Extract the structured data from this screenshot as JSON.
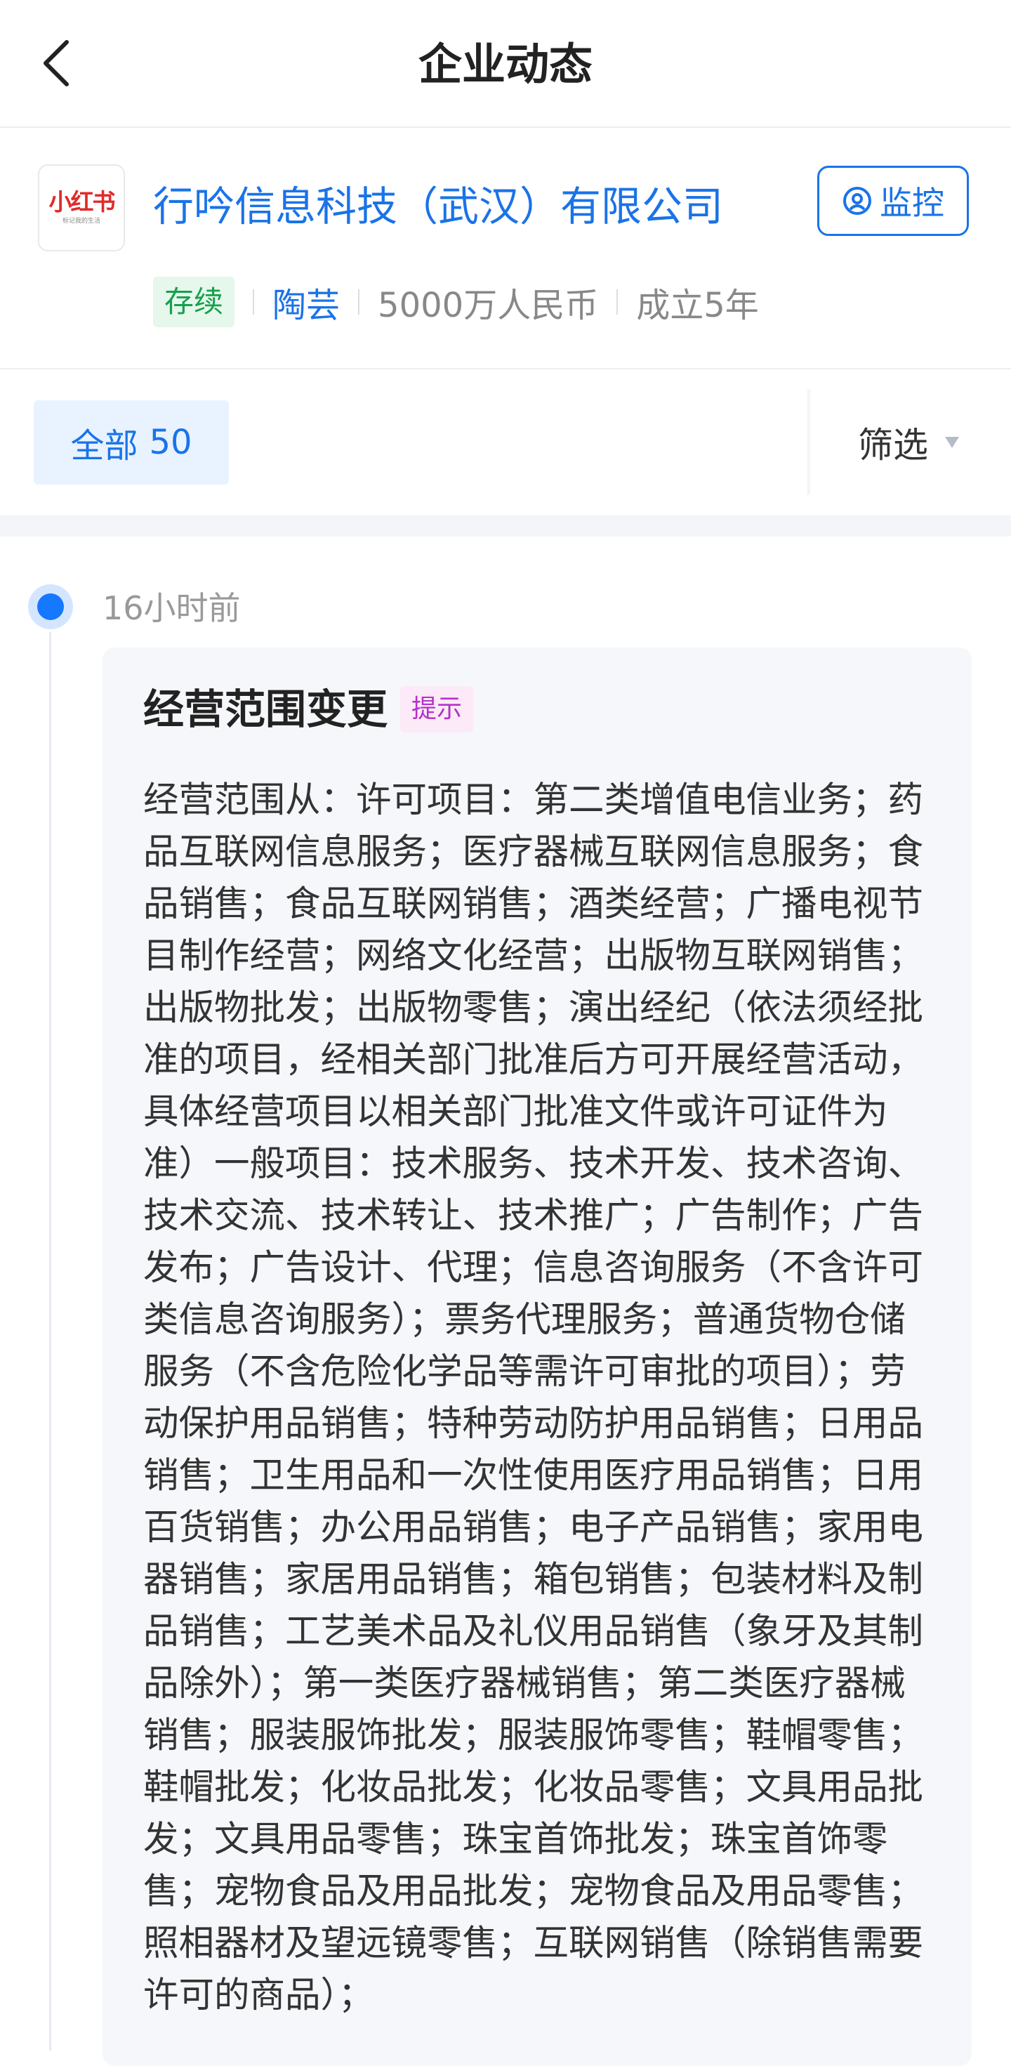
{
  "header": {
    "title": "企业动态",
    "back_icon": "chevron-left-icon"
  },
  "company": {
    "logo_text": "小红书",
    "logo_subtext": "标记我的生活",
    "name": "行吟信息科技（武汉）有限公司",
    "monitor_label": "监控",
    "monitor_icon": "monitor-eye-icon",
    "status": "存续",
    "legal_rep": "陶芸",
    "capital": "5000万人民币",
    "established": "成立5年"
  },
  "filters": {
    "all_label": "全部",
    "all_count": "50",
    "filter_label": "筛选",
    "filter_icon": "triangle-down-icon"
  },
  "timeline": {
    "time": "16小时前",
    "event_title": "经营范围变更",
    "hint_label": "提示",
    "content": "经营范围从：许可项目：第二类增值电信业务；药品互联网信息服务；医疗器械互联网信息服务；食品销售；食品互联网销售；酒类经营；广播电视节目制作经营；网络文化经营；出版物互联网销售；出版物批发；出版物零售；演出经纪（依法须经批准的项目，经相关部门批准后方可开展经营活动，具体经营项目以相关部门批准文件或许可证件为准）一般项目：技术服务、技术开发、技术咨询、技术交流、技术转让、技术推广；广告制作；广告发布；广告设计、代理；信息咨询服务（不含许可类信息咨询服务）；票务代理服务；普通货物仓储服务（不含危险化学品等需许可审批的项目）；劳动保护用品销售；特种劳动防护用品销售；日用品销售；卫生用品和一次性使用医疗用品销售；日用百货销售；办公用品销售；电子产品销售；家用电器销售；家居用品销售；箱包销售；包装材料及制品销售；工艺美术品及礼仪用品销售（象牙及其制品除外）；第一类医疗器械销售；第二类医疗器械销售；服装服饰批发；服装服饰零售；鞋帽零售；鞋帽批发；化妆品批发；化妆品零售；文具用品批发；文具用品零售；珠宝首饰批发；珠宝首饰零售；宠物食品及用品批发；宠物食品及用品零售；照相器材及望远镜零售；互联网销售（除销售需要许可的商品）；"
  },
  "colors": {
    "accent": "#1a73e8",
    "status_green": "#17a04b",
    "hint_purple": "#b233c8",
    "card_bg": "#f5f7fa"
  }
}
